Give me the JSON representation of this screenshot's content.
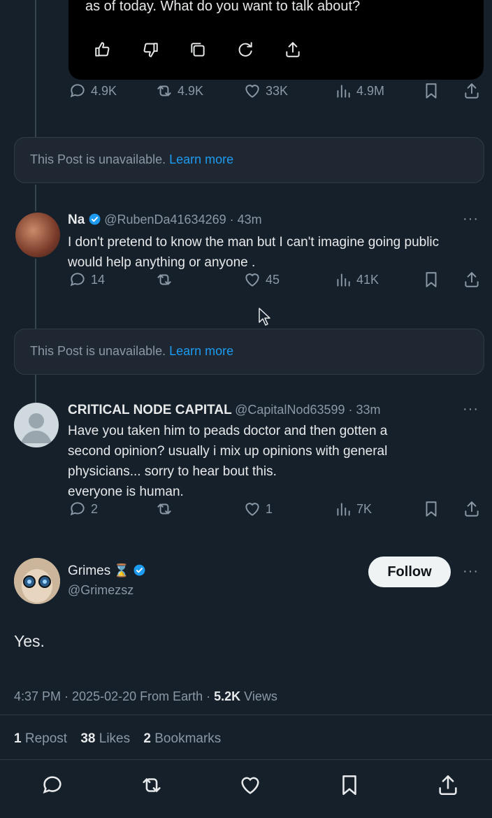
{
  "ai_card": {
    "text": "as of today. What do you want to talk about?",
    "icons": [
      "thumbs-up-icon",
      "thumbs-down-icon",
      "copy-icon",
      "regenerate-icon",
      "share-icon"
    ]
  },
  "post_actions": {
    "replies": "4.9K",
    "reposts": "4.9K",
    "likes": "33K",
    "views": "4.9M"
  },
  "unavailable_1": {
    "text": "This Post is unavailable.",
    "link": "Learn more"
  },
  "reply_1": {
    "name": "Na",
    "handle": "@RubenDa41634269 · 43m",
    "text": "I don't pretend to know the man but I can't imagine going public would help anything or anyone .",
    "replies": "14",
    "reposts": "",
    "likes": "45",
    "views": "41K"
  },
  "unavailable_2": {
    "text": "This Post is unavailable.",
    "link": "Learn more"
  },
  "reply_2": {
    "name": "CRITICAL NODE CAPITAL",
    "handle": "@CapitalNod63599 · 33m",
    "text_lines": [
      "Have you taken him to peads doctor and then gotten a",
      "second opinion? usually i mix up opinions with general",
      "physicians... sorry to hear bout this.",
      "everyone is human."
    ],
    "replies": "2",
    "reposts": "",
    "likes": "1",
    "views": "7K"
  },
  "main_post": {
    "name": "Grimes",
    "badge": "⌛",
    "handle": "@Grimezsz",
    "follow_label": "Follow",
    "text": "Yes.",
    "meta_time": "4:37 PM · 2025-02-20 From Earth · ",
    "meta_views_count": "5.2K",
    "meta_views_label": " Views",
    "reposts_count": "1",
    "reposts_label": " Repost",
    "likes_count": "38",
    "likes_label": " Likes",
    "bookmarks_count": "2",
    "bookmarks_label": " Bookmarks"
  },
  "colors": {
    "background": "#15202b",
    "accent": "#1d9bf0",
    "muted": "#8b98a5"
  }
}
